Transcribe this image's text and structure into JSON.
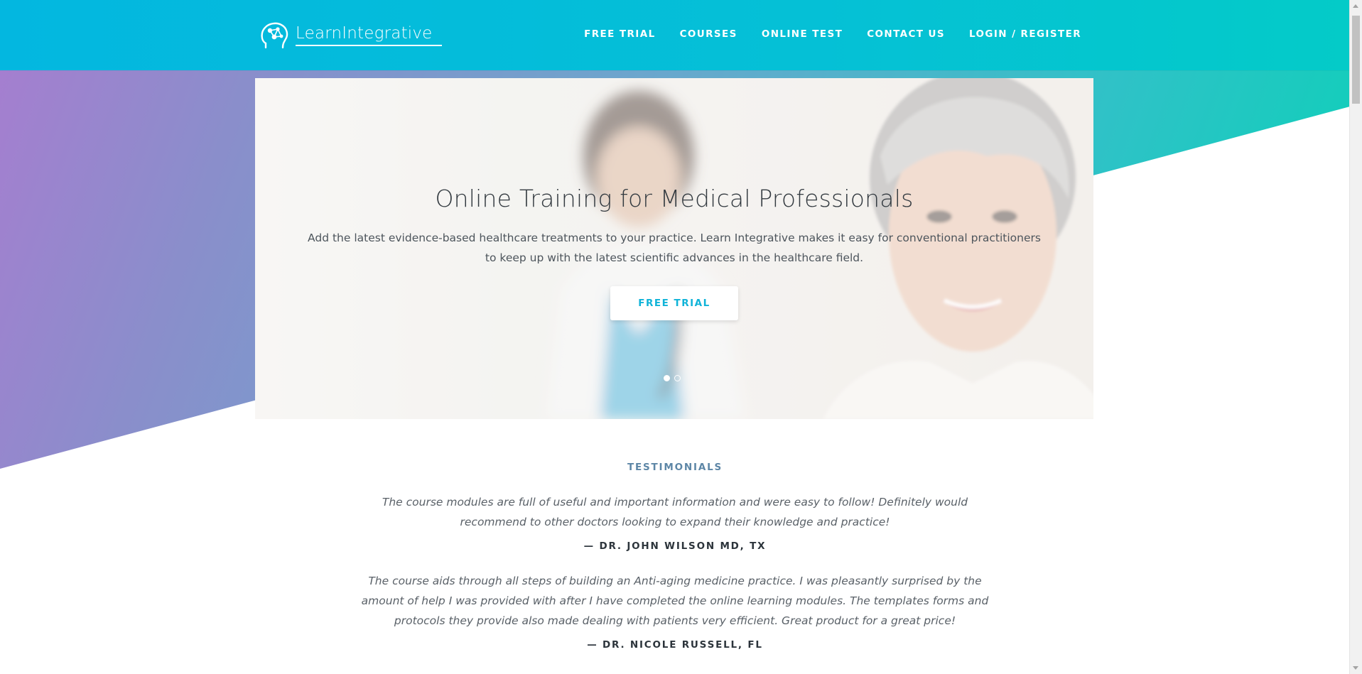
{
  "brand": {
    "name": "LearnIntegrative",
    "colors": {
      "header": "#05c0d6",
      "accent": "#0fb3d8",
      "gradient_start": "#a77dd0",
      "gradient_end": "#06d3b6"
    }
  },
  "nav": {
    "items": [
      {
        "label": "FREE TRIAL"
      },
      {
        "label": "COURSES"
      },
      {
        "label": "ONLINE TEST"
      },
      {
        "label": "CONTACT US"
      },
      {
        "label": "LOGIN / REGISTER"
      }
    ]
  },
  "hero": {
    "title": "Online Training for Medical Professionals",
    "subtitle": "Add the latest evidence-based healthcare treatments to your practice. Learn Integrative makes it easy for conventional practitioners to keep up with the latest scientific advances in the healthcare field.",
    "cta_label": "FREE TRIAL",
    "slides_total": 2,
    "active_slide": 1
  },
  "testimonials": {
    "heading": "TESTIMONIALS",
    "items": [
      {
        "quote": "The course modules are full of useful and important information and were easy to follow! Definitely would recommend to other doctors looking to expand their knowledge and practice!",
        "author": "— DR. JOHN WILSON MD, TX"
      },
      {
        "quote": "The course aids through all steps of building an Anti-aging medicine practice. I was pleasantly surprised by the amount of help I was provided with after I have completed the online learning modules. The templates forms and protocols they provide also made dealing with patients very efficient. Great product for a great price!",
        "author": "— DR. NICOLE RUSSELL, FL"
      }
    ]
  }
}
